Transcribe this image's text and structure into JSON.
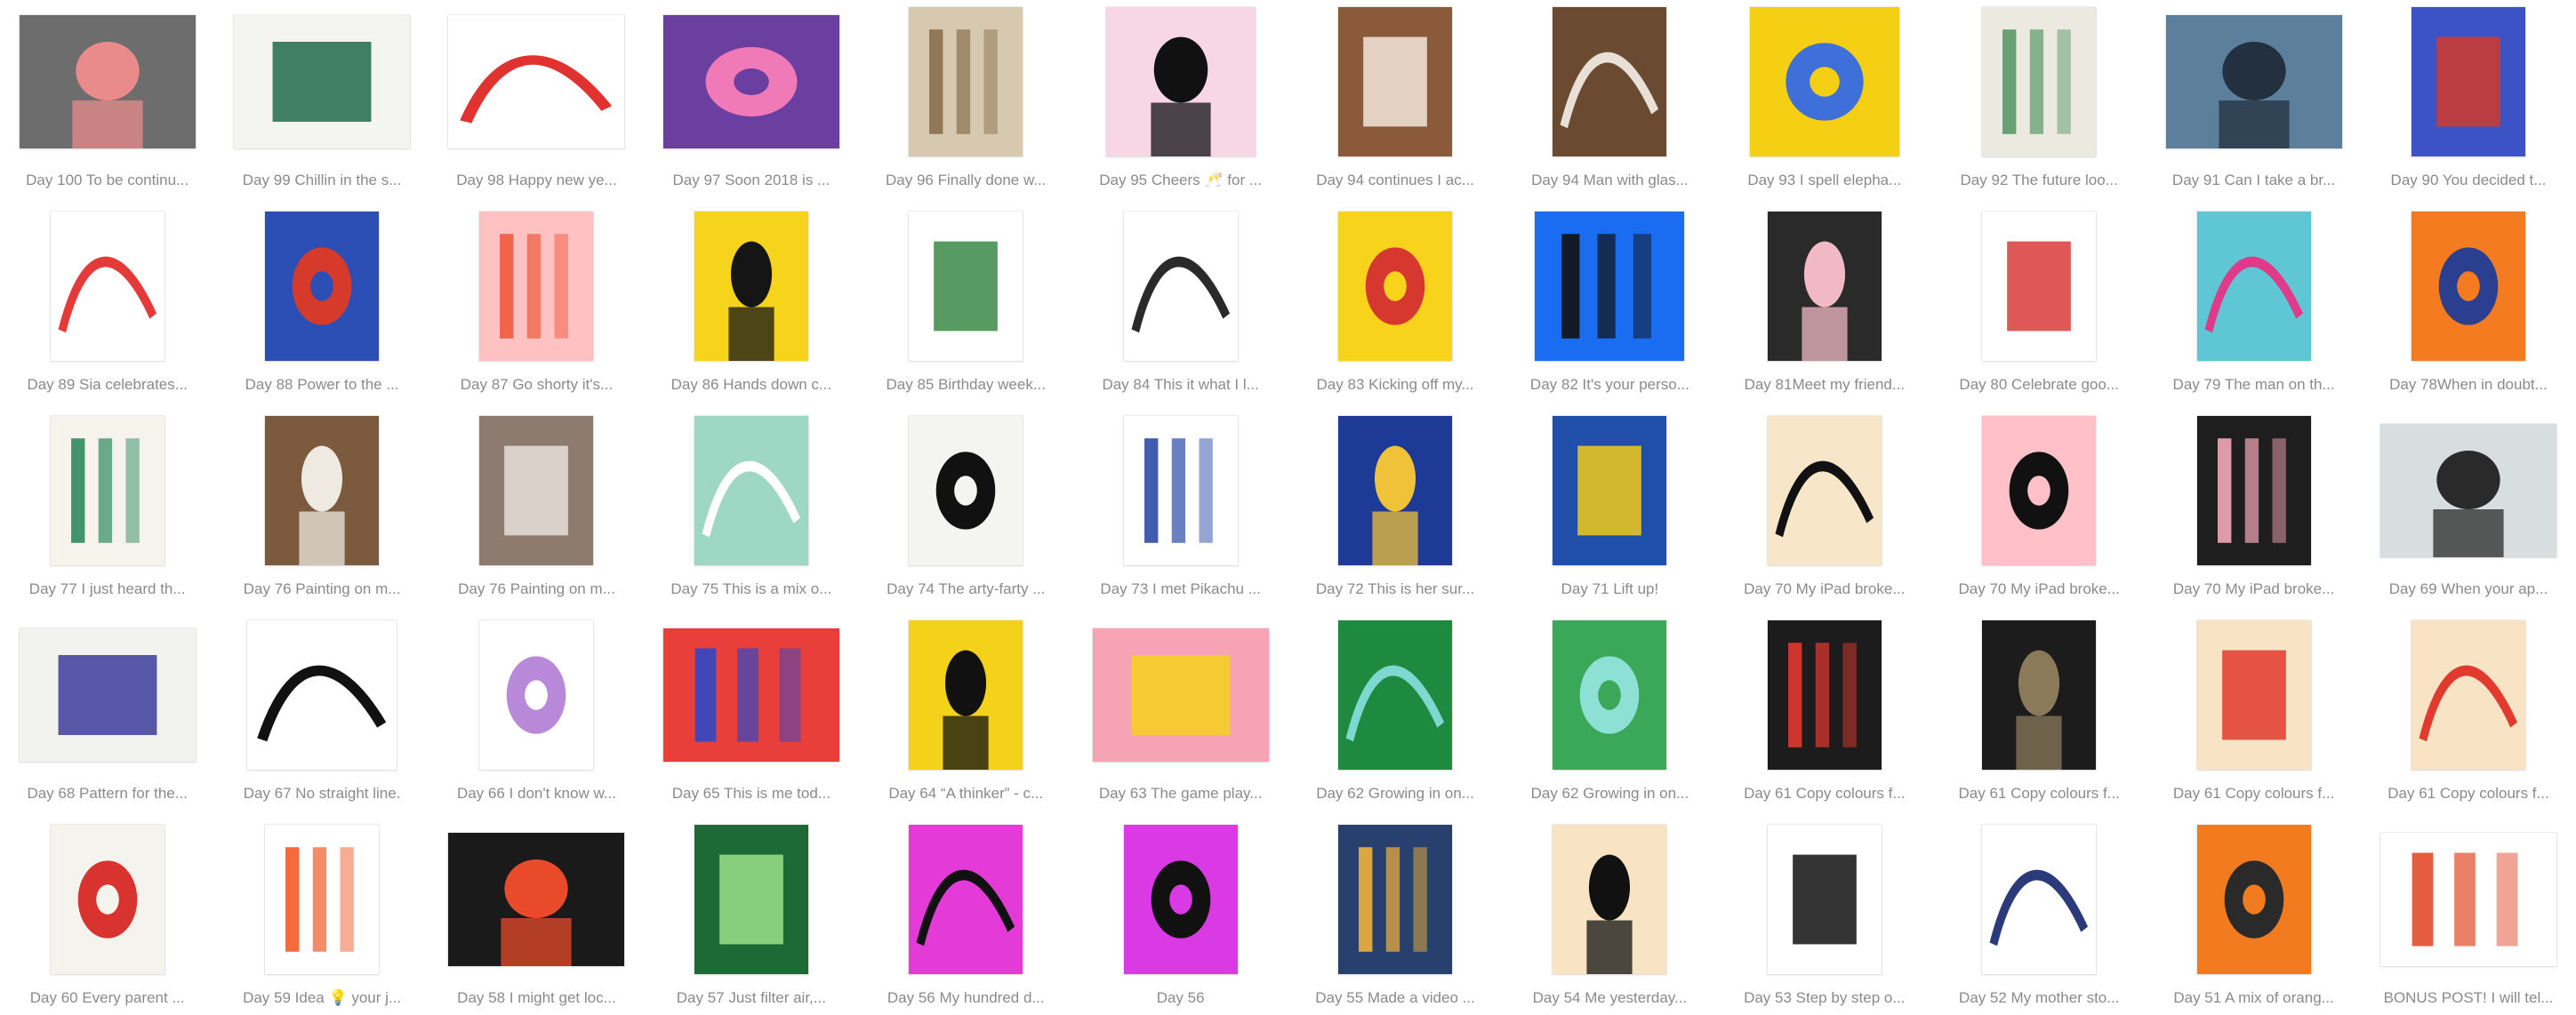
{
  "gallery": {
    "items": [
      {
        "caption": "Day 100 To be continu...",
        "bg": "#6d6d6d",
        "accent": "#e98b8b",
        "shape": "wide"
      },
      {
        "caption": "Day 99 Chillin in the s...",
        "bg": "#f4f4f0",
        "accent": "#1f6b4c",
        "shape": "wide"
      },
      {
        "caption": "Day 98 Happy new ye...",
        "bg": "#ffffff",
        "accent": "#e0322f",
        "shape": "wide"
      },
      {
        "caption": "Day 97 Soon 2018 is ...",
        "bg": "#6b3fa0",
        "accent": "#f07ab8",
        "shape": "wide"
      },
      {
        "caption": "Day 96 Finally done w...",
        "bg": "#d7c9b0",
        "accent": "#8a6f4d",
        "shape": "port"
      },
      {
        "caption": "Day 95 Cheers 🥂 for ...",
        "bg": "#f7d6e6",
        "accent": "#111111",
        "shape": "sq"
      },
      {
        "caption": "Day 94 continues I ac...",
        "bg": "#8b5a3a",
        "accent": "#f2e8dc",
        "shape": "port"
      },
      {
        "caption": "Day 94 Man with glas...",
        "bg": "#6a4a30",
        "accent": "#e8e0d6",
        "shape": "port"
      },
      {
        "caption": "Day 93 I spell elepha...",
        "bg": "#f5cf14",
        "accent": "#3f6fd8",
        "shape": "sq"
      },
      {
        "caption": "Day 92 The future loo...",
        "bg": "#ece9e0",
        "accent": "#5a9a68",
        "shape": "port"
      },
      {
        "caption": "Day 91 Can I take a br...",
        "bg": "#5c7f9c",
        "accent": "#23303f",
        "shape": "wide"
      },
      {
        "caption": "Day 90 You decided t...",
        "bg": "#3b53c4",
        "accent": "#d23a2c",
        "shape": "port"
      },
      {
        "caption": "Day 89 Sia celebrates...",
        "bg": "#ffffff",
        "accent": "#e43a3a",
        "shape": "port"
      },
      {
        "caption": "Day 88 Power to the ...",
        "bg": "#2b4fb4",
        "accent": "#d63a2b",
        "shape": "port"
      },
      {
        "caption": "Day 87 Go shorty it's...",
        "bg": "#ffc1c1",
        "accent": "#ef5a3c",
        "shape": "port"
      },
      {
        "caption": "Day 86 Hands down c...",
        "bg": "#f6d41b",
        "accent": "#151515",
        "shape": "port"
      },
      {
        "caption": "Day 85 Birthday week...",
        "bg": "#ffffff",
        "accent": "#3a8a46",
        "shape": "port"
      },
      {
        "caption": "Day 84 This it what I l...",
        "bg": "#ffffff",
        "accent": "#2a2a2a",
        "shape": "port"
      },
      {
        "caption": "Day 83 Kicking off my...",
        "bg": "#f8d31c",
        "accent": "#d6382f",
        "shape": "port"
      },
      {
        "caption": "Day 82 It's your perso...",
        "bg": "#1a6df0",
        "accent": "#111111",
        "shape": "sq"
      },
      {
        "caption": "Day 81Meet my friend...",
        "bg": "#2a2a2a",
        "accent": "#f1b9c4",
        "shape": "port"
      },
      {
        "caption": "Day 80 Celebrate goo...",
        "bg": "#ffffff",
        "accent": "#d93a3a",
        "shape": "port"
      },
      {
        "caption": "Day 79 The man on th...",
        "bg": "#5fc6d4",
        "accent": "#e03b8a",
        "shape": "port"
      },
      {
        "caption": "Day 78When in doubt...",
        "bg": "#f47b20",
        "accent": "#2a3f8f",
        "shape": "port"
      },
      {
        "caption": "Day 77 I just heard th...",
        "bg": "#f5f3ec",
        "accent": "#2f8a5e",
        "shape": "port"
      },
      {
        "caption": "Day 76 Painting on m...",
        "bg": "#7b5a3d",
        "accent": "#eeeae2",
        "shape": "port"
      },
      {
        "caption": "Day 76 Painting on m...",
        "bg": "#8c7b6e",
        "accent": "#e8e2da",
        "shape": "port"
      },
      {
        "caption": "Day 75 This is a mix o...",
        "bg": "#9ed8c4",
        "accent": "#ffffff",
        "shape": "port"
      },
      {
        "caption": "Day 74 The arty-farty ...",
        "bg": "#f4f4f0",
        "accent": "#111111",
        "shape": "port"
      },
      {
        "caption": "Day 73 I met Pikachu ...",
        "bg": "#ffffff",
        "accent": "#2a4aa8",
        "shape": "port"
      },
      {
        "caption": "Day 72 This is her sur...",
        "bg": "#1d3a96",
        "accent": "#f0c23a",
        "shape": "port"
      },
      {
        "caption": "Day 71 Lift up!",
        "bg": "#1f4fa8",
        "accent": "#f3c91a",
        "shape": "port"
      },
      {
        "caption": "Day 70 My iPad broke...",
        "bg": "#f8e6c8",
        "accent": "#111111",
        "shape": "port"
      },
      {
        "caption": "Day 70 My iPad broke...",
        "bg": "#ffc0c8",
        "accent": "#111111",
        "shape": "port"
      },
      {
        "caption": "Day 70 My iPad broke...",
        "bg": "#1e1e1e",
        "accent": "#f3a7b8",
        "shape": "port"
      },
      {
        "caption": "Day 69 When your ap...",
        "bg": "#d8dde0",
        "accent": "#2a2a2a",
        "shape": "wide"
      },
      {
        "caption": "Day 68 Pattern for the...",
        "bg": "#f2f2ee",
        "accent": "#3c3c9a",
        "shape": "wide"
      },
      {
        "caption": "Day 67 No straight line.",
        "bg": "#ffffff",
        "accent": "#111111",
        "shape": "sq"
      },
      {
        "caption": "Day 66 I don't know w...",
        "bg": "#ffffff",
        "accent": "#b889d8",
        "shape": "port"
      },
      {
        "caption": "Day 65 This is me tod...",
        "bg": "#e83f3a",
        "accent": "#2f48c8",
        "shape": "wide"
      },
      {
        "caption": "Day 64 “A thinker” - c...",
        "bg": "#f5d21a",
        "accent": "#111111",
        "shape": "port"
      },
      {
        "caption": "Day 63 The game play...",
        "bg": "#f6a3b5",
        "accent": "#f4d11c",
        "shape": "wide"
      },
      {
        "caption": "Day 62 Growing in on...",
        "bg": "#1d8a3f",
        "accent": "#7fd8d0",
        "shape": "port"
      },
      {
        "caption": "Day 62 Growing in on...",
        "bg": "#3aa858",
        "accent": "#8de0d4",
        "shape": "port"
      },
      {
        "caption": "Day 61 Copy colours f...",
        "bg": "#1c1c1c",
        "accent": "#e23a2e",
        "shape": "port"
      },
      {
        "caption": "Day 61 Copy colours f...",
        "bg": "#1c1c1c",
        "accent": "#8a7a5a",
        "shape": "port"
      },
      {
        "caption": "Day 61 Copy colours f...",
        "bg": "#f8e3c4",
        "accent": "#e23a2e",
        "shape": "port"
      },
      {
        "caption": "Day 61 Copy colours f...",
        "bg": "#f8e3c4",
        "accent": "#e23a2e",
        "shape": "port"
      },
      {
        "caption": "Day 60  Every parent ...",
        "bg": "#f4f3ee",
        "accent": "#d8332e",
        "shape": "port"
      },
      {
        "caption": "Day 59 Idea 💡 your j...",
        "bg": "#ffffff",
        "accent": "#f25a2a",
        "shape": "port"
      },
      {
        "caption": "Day 58 I might get loc...",
        "bg": "#1a1a1a",
        "accent": "#e84a2a",
        "shape": "wide"
      },
      {
        "caption": "Day 57 Just filter air,...",
        "bg": "#1d6a36",
        "accent": "#9be08a",
        "shape": "port"
      },
      {
        "caption": "Day 56 My hundred d...",
        "bg": "#e43ad8",
        "accent": "#111111",
        "shape": "port"
      },
      {
        "caption": "Day 56",
        "bg": "#d93ae4",
        "accent": "#111111",
        "shape": "port"
      },
      {
        "caption": "Day 55 Made a video ...",
        "bg": "#27406e",
        "accent": "#f1b23a",
        "shape": "port"
      },
      {
        "caption": "Day 54 Me yesterday...",
        "bg": "#f8e3c2",
        "accent": "#111111",
        "shape": "port"
      },
      {
        "caption": "Day 53 Step by step o...",
        "bg": "#ffffff",
        "accent": "#111111",
        "shape": "port"
      },
      {
        "caption": "Day 52 My mother sto...",
        "bg": "#ffffff",
        "accent": "#2a3a7a",
        "shape": "port"
      },
      {
        "caption": "Day 51 A mix of orang...",
        "bg": "#f27a1f",
        "accent": "#2a2a2a",
        "shape": "port"
      },
      {
        "caption": "BONUS POST! I will tel...",
        "bg": "#ffffff",
        "accent": "#e24a2a",
        "shape": "wide"
      }
    ]
  }
}
